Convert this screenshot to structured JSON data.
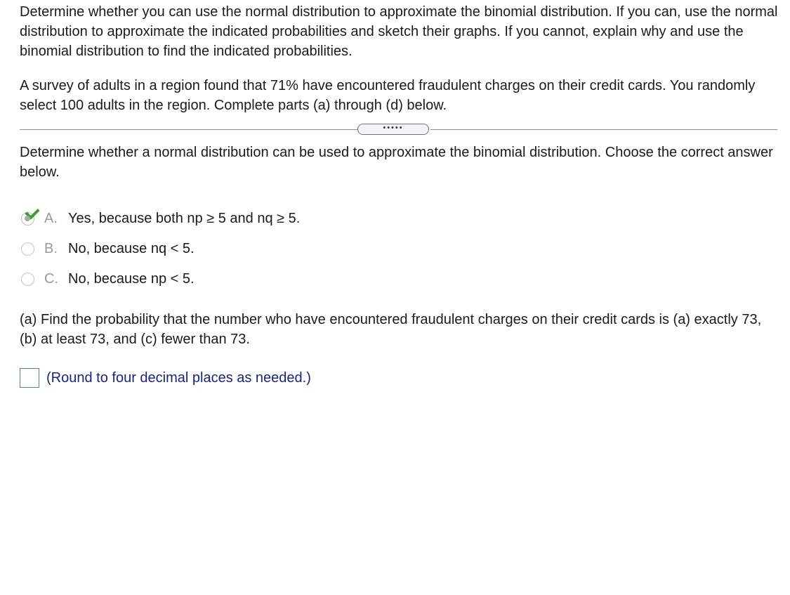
{
  "instructions": "Determine whether you can use the normal distribution to approximate the binomial distribution. If you can, use the normal distribution to approximate the indicated probabilities and sketch their graphs. If you cannot, explain why and use the binomial distribution to find the indicated probabilities.",
  "problem": "A survey of adults in a region found that 71% have encountered fraudulent charges on their credit cards. You randomly select 100 adults in the region. Complete parts (a) through (d) below.",
  "divider": {
    "handle_label": "•••••"
  },
  "question": "Determine whether a normal distribution can be used to approximate the binomial distribution. Choose the correct answer below.",
  "choices": [
    {
      "letter": "A.",
      "text": "Yes, because both np ≥ 5 and nq ≥ 5.",
      "selected": true,
      "correct": true
    },
    {
      "letter": "B.",
      "text": "No, because nq < 5.",
      "selected": false
    },
    {
      "letter": "C.",
      "text": "No, because np < 5.",
      "selected": false
    }
  ],
  "part_a": {
    "prompt": "(a) Find the probability that the number who have encountered fraudulent charges on their credit cards is (a) exactly 73, (b) at least 73, and (c) fewer than 73.",
    "answer_value": "",
    "hint": "(Round to four decimal places as needed.)"
  },
  "colors": {
    "check": "#3f9c35",
    "hint": "#1a237e",
    "input_border": "#4a7fa6"
  }
}
